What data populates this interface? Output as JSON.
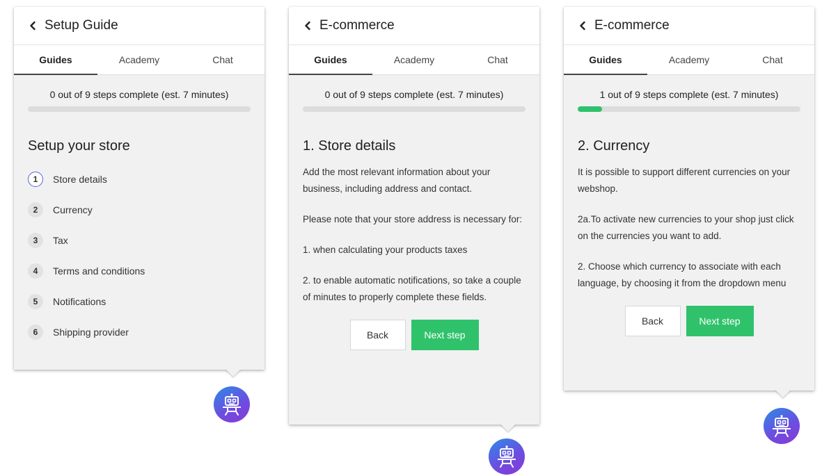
{
  "tabs": [
    "Guides",
    "Academy",
    "Chat"
  ],
  "colors": {
    "accent": "#2fc26b",
    "active_step_ring": "#5b62d6",
    "bot_gradient": [
      "#2b8ce8",
      "#8a38d8"
    ]
  },
  "icons": {
    "back": "chevron-left-icon",
    "assistant": "robot-icon"
  },
  "panel1": {
    "title": "Setup Guide",
    "progress_text": "0 out of 9 steps complete (est. 7 minutes)",
    "progress": 0,
    "section_title": "Setup your store",
    "steps": [
      {
        "num": "1",
        "label": "Store details"
      },
      {
        "num": "2",
        "label": "Currency"
      },
      {
        "num": "3",
        "label": "Tax"
      },
      {
        "num": "4",
        "label": "Terms and conditions"
      },
      {
        "num": "5",
        "label": "Notifications"
      },
      {
        "num": "6",
        "label": "Shipping provider"
      }
    ]
  },
  "panel2": {
    "title": "E-commerce",
    "progress_text": "0 out of 9 steps complete (est. 7 minutes)",
    "progress": 0,
    "section_title": "1. Store details",
    "paragraphs": [
      "Add the most relevant information about your business, including address and contact.",
      "Please note that your store address is necessary for:",
      "1. when calculating your products taxes",
      "2. to enable automatic notifications, so take a couple of minutes to properly complete these fields."
    ],
    "back_label": "Back",
    "next_label": "Next step"
  },
  "panel3": {
    "title": "E-commerce",
    "progress_text": "1 out of 9 steps complete (est. 7 minutes)",
    "progress": 0.11,
    "section_title": "2. Currency",
    "paragraphs": [
      "It is possible to support different currencies on your webshop.",
      "2a.To activate new currencies to your shop just click on the currencies you want to add.",
      "2. Choose which currency to associate with each language, by choosing it from the dropdown menu"
    ],
    "back_label": "Back",
    "next_label": "Next step"
  }
}
